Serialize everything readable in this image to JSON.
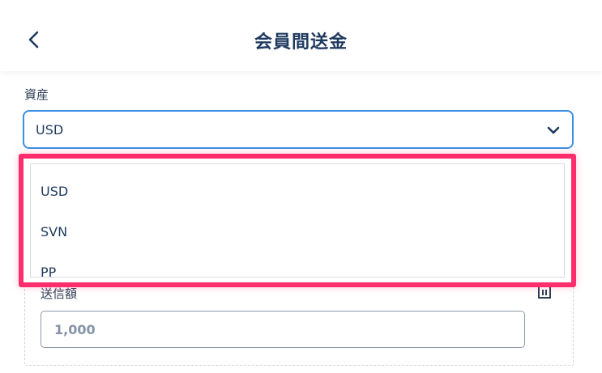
{
  "header": {
    "title": "会員間送金",
    "back_icon": "chevron-left-icon"
  },
  "asset": {
    "label": "資産",
    "selected": "USD",
    "options": [
      "USD",
      "SVN",
      "PP"
    ]
  },
  "amount": {
    "label": "送信額",
    "placeholder": "1,000"
  },
  "colors": {
    "accent": "#3b8ee6",
    "highlight": "#ff2d6b",
    "text": "#1f3a5f"
  }
}
